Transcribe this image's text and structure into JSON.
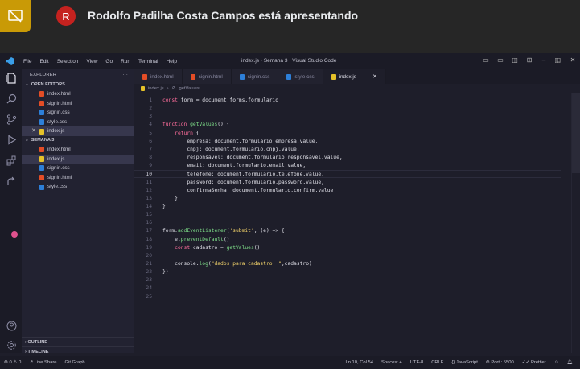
{
  "meet": {
    "avatar_initial": "R",
    "presenting_text": "Rodolfo Padilha Costa Campos está apresentando"
  },
  "window": {
    "menu": [
      "File",
      "Edit",
      "Selection",
      "View",
      "Go",
      "Run",
      "Terminal",
      "Help"
    ],
    "title": "index.js · Semana 3 · Visual Studio Code"
  },
  "sidebar": {
    "explorer_label": "EXPLORER",
    "open_editors_label": "OPEN EDITORS",
    "open_editors": [
      {
        "name": "index.html",
        "type": "html"
      },
      {
        "name": "signin.html",
        "type": "html"
      },
      {
        "name": "signin.css",
        "type": "css"
      },
      {
        "name": "style.css",
        "type": "css"
      },
      {
        "name": "index.js",
        "type": "js"
      }
    ],
    "folder_label": "SEMANA 3",
    "folder_files": [
      {
        "name": "index.html",
        "type": "html"
      },
      {
        "name": "index.js",
        "type": "js"
      },
      {
        "name": "signin.css",
        "type": "css"
      },
      {
        "name": "signin.html",
        "type": "html"
      },
      {
        "name": "style.css",
        "type": "css"
      }
    ],
    "outline_label": "OUTLINE",
    "timeline_label": "TIMELINE"
  },
  "tabs": [
    {
      "name": "index.html",
      "type": "html"
    },
    {
      "name": "signin.html",
      "type": "html"
    },
    {
      "name": "signin.css",
      "type": "css"
    },
    {
      "name": "style.css",
      "type": "css"
    },
    {
      "name": "index.js",
      "type": "js"
    }
  ],
  "breadcrumb": {
    "file": "index.js",
    "symbol": "getValues"
  },
  "editor": {
    "lines": [
      "const form = document.forms.formulario",
      "",
      "",
      "function getValues() {",
      "    return {",
      "        empresa: document.formulario.empresa.value,",
      "        cnpj: document.formulario.cnpj.value,",
      "        responsavel: document.formulario.responsavel.value,",
      "        email: document.formulario.email.value,",
      "        telefone: document.formulario.telefone.value,",
      "        password: document.formulario.password.value,",
      "        confirmaSenha: document.formulario.confirm.value",
      "    }",
      "}",
      "",
      "",
      "form.addEventListener('submit', (e) => {",
      "    e.preventDefault()",
      "    const cadastro = getValues()",
      "",
      "    console.log(\"dados para cadastro: \",cadastro)",
      "})",
      "",
      "",
      ""
    ]
  },
  "status": {
    "problems": "0 ⚠ 0",
    "live_share": "Live Share",
    "git_graph": "Git Graph",
    "cursor": "Ln 10, Col 54",
    "spaces": "Spaces: 4",
    "encoding": "UTF-8",
    "eol": "CRLF",
    "language": "JavaScript",
    "port": "Port : 5500",
    "prettier": "Prettier"
  },
  "colors": {
    "meet_bg": "#262626",
    "editor_bg": "#1e1e2a",
    "sidebar_bg": "#222231",
    "keyword": "#ff6e9c",
    "function": "#7fe08a",
    "string": "#f5d56b",
    "meet_tile": "#c99a06",
    "avatar": "#c5221f"
  }
}
